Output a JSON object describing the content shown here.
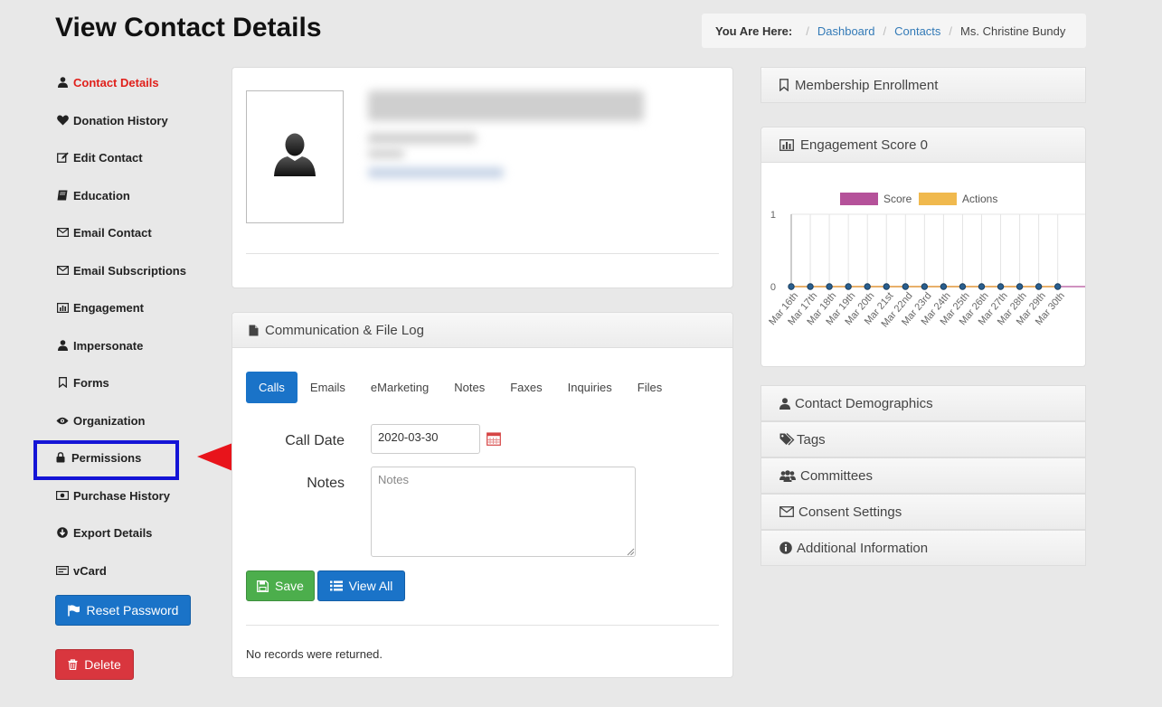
{
  "page": {
    "title": "View Contact Details"
  },
  "breadcrumb": {
    "label": "You Are Here:",
    "items": [
      "Dashboard",
      "Contacts"
    ],
    "current": "Ms. Christine Bundy"
  },
  "sidebar": {
    "items": [
      {
        "label": "Contact Details",
        "icon": "user-icon"
      },
      {
        "label": "Donation History",
        "icon": "heart-icon"
      },
      {
        "label": "Edit Contact",
        "icon": "edit-icon"
      },
      {
        "label": "Education",
        "icon": "book-icon"
      },
      {
        "label": "Email Contact",
        "icon": "envelope-icon"
      },
      {
        "label": "Email Subscriptions",
        "icon": "envelope-icon"
      },
      {
        "label": "Engagement",
        "icon": "bar-chart-icon"
      },
      {
        "label": "Impersonate",
        "icon": "user-icon"
      },
      {
        "label": "Forms",
        "icon": "bookmark-icon"
      },
      {
        "label": "Organization",
        "icon": "eye-icon"
      },
      {
        "label": "Permissions",
        "icon": "lock-icon"
      },
      {
        "label": "Purchase History",
        "icon": "money-icon"
      },
      {
        "label": "Export Details",
        "icon": "download-icon"
      },
      {
        "label": "vCard",
        "icon": "card-icon"
      }
    ],
    "reset_password": "Reset Password",
    "delete": "Delete"
  },
  "comm_log": {
    "title": "Communication & File Log",
    "tabs": [
      "Calls",
      "Emails",
      "eMarketing",
      "Notes",
      "Faxes",
      "Inquiries",
      "Files"
    ],
    "call_date_label": "Call Date",
    "call_date_value": "2020-03-30",
    "notes_label": "Notes",
    "notes_placeholder": "Notes",
    "save": "Save",
    "view_all": "View All",
    "no_records": "No records were returned."
  },
  "right": {
    "membership": "Membership Enrollment",
    "engagement_title": "Engagement Score 0",
    "accordion": [
      "Contact Demographics",
      "Tags",
      "Committees",
      "Consent Settings",
      "Additional Information"
    ]
  },
  "colors": {
    "accent": "#1a73c8",
    "active": "#e0201b",
    "score": "#b5529a",
    "actions": "#f0b94e",
    "highlight": "#1414d6",
    "arrow": "#e8141b"
  },
  "chart_data": {
    "type": "line",
    "categories": [
      "Mar 16th",
      "Mar 17th",
      "Mar 18th",
      "Mar 19th",
      "Mar 20th",
      "Mar 21st",
      "Mar 22nd",
      "Mar 23rd",
      "Mar 24th",
      "Mar 25th",
      "Mar 26th",
      "Mar 27th",
      "Mar 28th",
      "Mar 29th",
      "Mar 30th"
    ],
    "series": [
      {
        "name": "Score",
        "values": [
          0,
          0,
          0,
          0,
          0,
          0,
          0,
          0,
          0,
          0,
          0,
          0,
          0,
          0,
          0
        ]
      },
      {
        "name": "Actions",
        "values": [
          0,
          0,
          0,
          0,
          0,
          0,
          0,
          0,
          0,
          0,
          0,
          0,
          0,
          0,
          0
        ]
      }
    ],
    "ylim": [
      0,
      1
    ],
    "yticks": [
      "0",
      "1"
    ],
    "legend": "top"
  }
}
